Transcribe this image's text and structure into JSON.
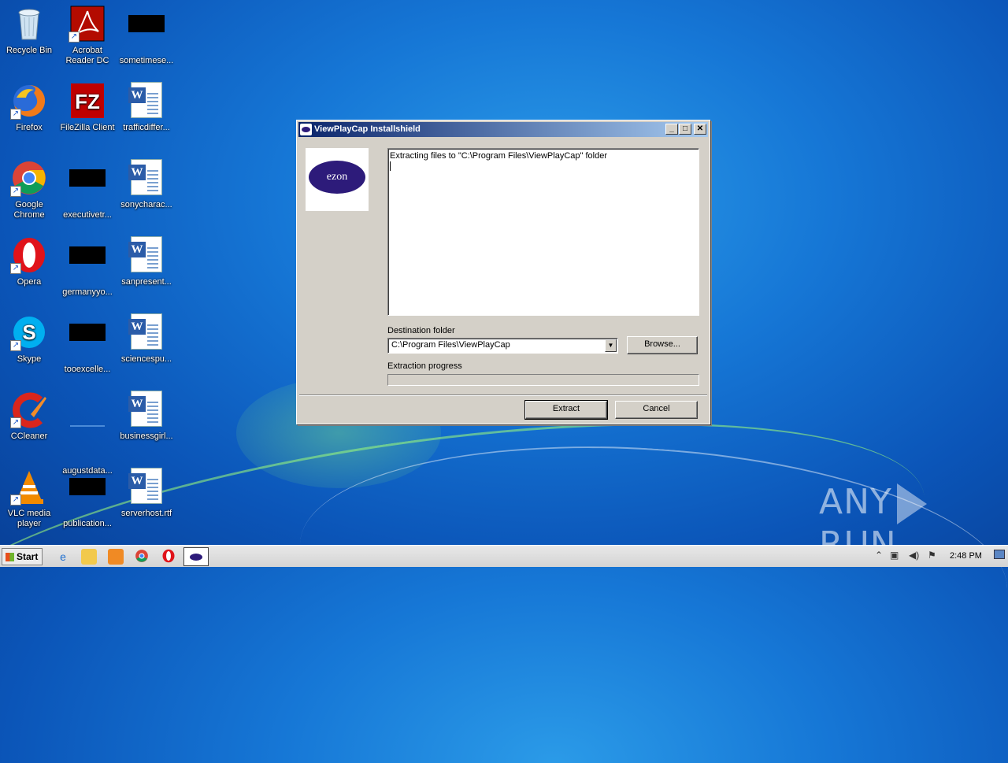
{
  "desktop": {
    "icons": [
      {
        "label": "Recycle Bin",
        "icon": "recycle-bin-icon"
      },
      {
        "label": "Acrobat Reader DC",
        "icon": "acrobat-icon"
      },
      {
        "label": "sometimese...",
        "icon": "black-thumbnail-icon"
      },
      {
        "label": "Firefox",
        "icon": "firefox-icon"
      },
      {
        "label": "FileZilla Client",
        "icon": "filezilla-icon"
      },
      {
        "label": "trafficdiffer...",
        "icon": "word-doc-icon"
      },
      {
        "label": "Google Chrome",
        "icon": "chrome-icon"
      },
      {
        "label": "executivetr...",
        "icon": "black-thumbnail-icon"
      },
      {
        "label": "sonycharac...",
        "icon": "word-doc-icon"
      },
      {
        "label": "Opera",
        "icon": "opera-icon"
      },
      {
        "label": "germanyyo...",
        "icon": "black-thumbnail-icon"
      },
      {
        "label": "sanpresent...",
        "icon": "word-doc-icon"
      },
      {
        "label": "Skype",
        "icon": "skype-icon"
      },
      {
        "label": "tooexcelle...",
        "icon": "black-thumbnail-icon"
      },
      {
        "label": "sciencespu...",
        "icon": "word-doc-icon"
      },
      {
        "label": "CCleaner",
        "icon": "ccleaner-icon"
      },
      {
        "label": "augustdata...",
        "icon": "blank-thumbnail-icon"
      },
      {
        "label": "businessgirl...",
        "icon": "word-doc-icon"
      },
      {
        "label": "VLC media player",
        "icon": "vlc-icon"
      },
      {
        "label": "publication...",
        "icon": "black-thumbnail-icon"
      },
      {
        "label": "serverhost.rtf",
        "icon": "word-doc-icon"
      }
    ]
  },
  "dialog": {
    "title": "ViewPlayCap Installshield",
    "logo_text": "ezon",
    "log_text": "Extracting files to \"C:\\Program Files\\ViewPlayCap\" folder",
    "destination_label": "Destination folder",
    "destination_value": "C:\\Program Files\\ViewPlayCap",
    "browse_label": "Browse...",
    "progress_label": "Extraction progress",
    "progress": 0,
    "extract_label": "Extract",
    "cancel_label": "Cancel"
  },
  "watermark": {
    "left": "ANY",
    "right": "RUN"
  },
  "taskbar": {
    "start_label": "Start",
    "pinned": [
      "internet-explorer-icon",
      "explorer-folder-icon",
      "media-player-icon",
      "chrome-icon",
      "opera-icon"
    ],
    "clock": "2:48 PM"
  }
}
